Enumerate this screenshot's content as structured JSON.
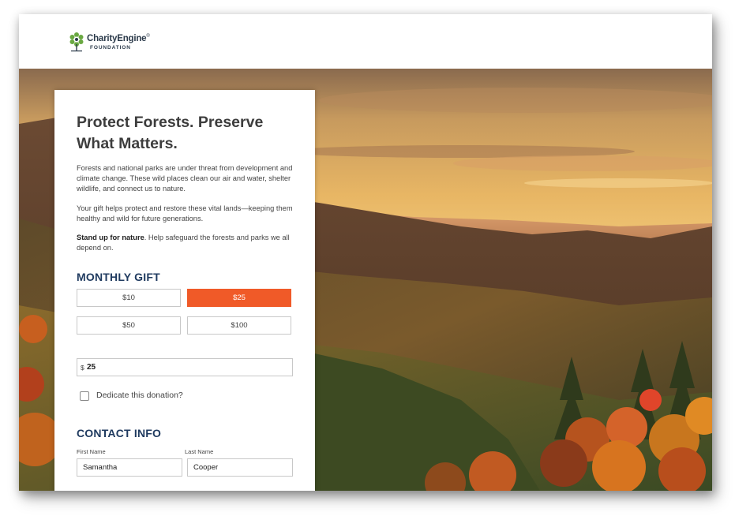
{
  "brand": {
    "name": "CharityEngine",
    "trademark": "®",
    "subtitle": "FOUNDATION",
    "colors": {
      "green": "#6aa842",
      "navy": "#2b3a4a"
    }
  },
  "hero": {
    "description_icon": "mountain-sunset-background"
  },
  "form": {
    "title": "Protect Forests. Preserve What Matters.",
    "intro_1": "Forests and national parks are under threat from development and climate change. These wild places clean our air and water, shelter wildlife, and connect us to nature.",
    "intro_2": "Your gift helps protect and restore these vital lands—keeping them healthy and wild for future generations.",
    "intro_3_bold": "Stand up for nature",
    "intro_3_rest": ". Help safeguard the forests and parks we all depend on.",
    "monthly_gift_heading": "MONTHLY GIFT",
    "amounts": [
      {
        "label": "$10",
        "selected": false
      },
      {
        "label": "$25",
        "selected": true
      },
      {
        "label": "$50",
        "selected": false
      },
      {
        "label": "$100",
        "selected": false
      }
    ],
    "custom_amount": {
      "currency": "$",
      "value": "25"
    },
    "dedicate_label": "Dedicate this donation?",
    "dedicate_checked": false,
    "contact_heading": "CONTACT INFO",
    "first_name_label": "First Name",
    "first_name_value": "Samantha",
    "last_name_label": "Last Name",
    "last_name_value": "Cooper",
    "accent_color": "#f05a28",
    "heading_color": "#1f3a5f"
  }
}
